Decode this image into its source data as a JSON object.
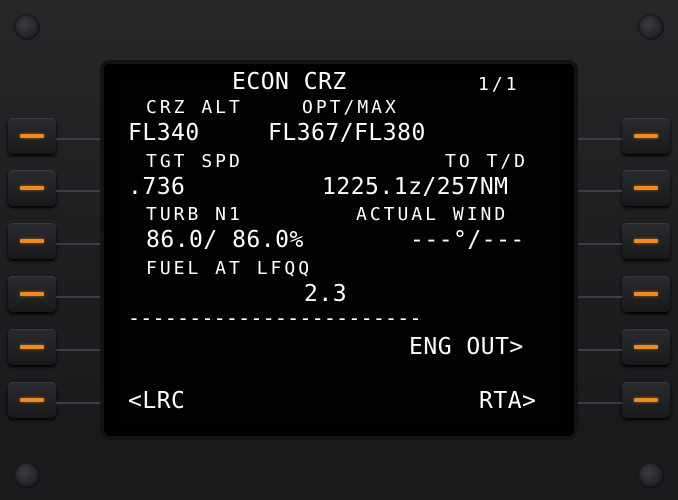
{
  "page": {
    "title": "ECON CRZ",
    "page_number": "1/1"
  },
  "rows": {
    "crz_alt_label": "CRZ ALT",
    "opt_max_label": "OPT/MAX",
    "crz_alt_value": "FL340",
    "opt_max_value": "FL367/FL380",
    "tgt_spd_label": "TGT SPD",
    "to_td_label": "TO T/D",
    "tgt_spd_value": ".736",
    "to_td_value": "1225.1z/257NM",
    "turb_n1_label": "TURB N1",
    "actual_wind_label": "ACTUAL WIND",
    "turb_n1_value": "86.0/ 86.0%",
    "actual_wind_value": "---°/---",
    "fuel_label": "FUEL AT LFQQ",
    "fuel_value": "2.3",
    "separator": "------------------------",
    "eng_out_prompt": "ENG OUT>",
    "lrc_prompt": "<LRC",
    "rta_prompt": "RTA>"
  },
  "colors": {
    "text": "#ffffff",
    "lsk_bar": "#f08a1c",
    "screen": "#020203",
    "bezel": "#1d1e20"
  }
}
